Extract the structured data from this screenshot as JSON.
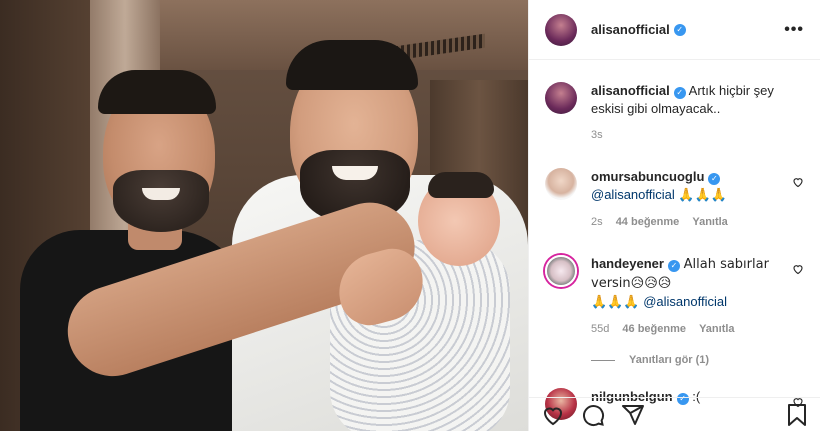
{
  "post": {
    "username": "alisanofficial",
    "caption": "Artık hiçbir şey eskisi gibi olmayacak..",
    "time": "3s"
  },
  "comments": [
    {
      "username": "omursabuncuoglu",
      "mention": "@alisanofficial",
      "text": "🙏🙏🙏",
      "time": "2s",
      "likes": "44 beğenme",
      "reply": "Yanıtla"
    },
    {
      "username": "handeyener",
      "text_pre": "Allah sabırlar versin😥😥😥",
      "text_post": "🙏🙏🙏",
      "mention": "@alisanofficial",
      "time": "55d",
      "likes": "46 beğenme",
      "reply": "Yanıtla",
      "view_replies": "Yanıtları gör (1)"
    },
    {
      "username": "nilgunbelgun",
      "text": ":("
    }
  ],
  "icons": {
    "more": "more-options-icon",
    "verified": "verified-badge-icon",
    "like": "heart-icon",
    "comment": "comment-icon",
    "share": "share-icon",
    "save": "bookmark-icon"
  },
  "colors": {
    "verified": "#3897f0",
    "mention": "#00376b",
    "muted": "#8e8e8e"
  }
}
